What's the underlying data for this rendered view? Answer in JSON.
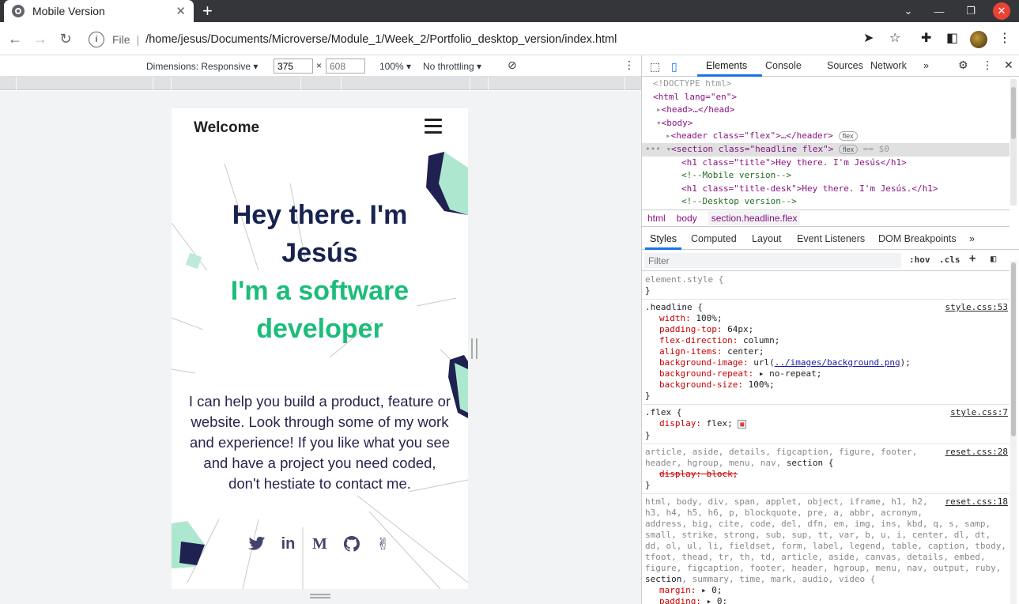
{
  "browser": {
    "tab_title": "Mobile Version",
    "omnibox": {
      "file_label": "File",
      "url": "/home/jesus/Documents/Microverse/Module_1/Week_2/Portfolio_desktop_version/index.html"
    }
  },
  "device_toolbar": {
    "dimensions_label": "Dimensions: Responsive",
    "width": "375",
    "times": "×",
    "height_placeholder": "608",
    "zoom": "100%",
    "throttling": "No throttling"
  },
  "page": {
    "logo": "Welcome",
    "headline_line1": "Hey there. I'm",
    "headline_line2": "Jesús",
    "subheadline_line1": "I'm a software",
    "subheadline_line2": "developer",
    "paragraph": "I can help you build a product, feature or website. Look through some of my work and experience! If you like what you see and have a project you need coded, don't hestiate to contact me.",
    "social_icons": [
      "twitter-icon",
      "linkedin-icon",
      "medium-icon",
      "github-icon",
      "angellist-icon"
    ],
    "colors": {
      "heading": "#172250",
      "accent": "#1cbd7a",
      "text": "#27254d"
    }
  },
  "devtools": {
    "tabs": [
      "Elements",
      "Console",
      "Sources",
      "Network"
    ],
    "dom": {
      "doctype": "<!DOCTYPE html>",
      "html_open": "<html lang=\"en\">",
      "head": "<head>…</head>",
      "body_open": "<body>",
      "header": "<header class=\"flex\">…</header>",
      "section": "<section class=\"headline flex\">",
      "selected_marker": "== $0",
      "h1_title": "<h1 class=\"title\">Hey there. I'm Jesús</h1>",
      "comment_mobile": "<!--Mobile version-->",
      "h1_desk": "<h1 class=\"title-desk\">Hey there. I'm Jesús.</h1>",
      "comment_desktop": "<!--Desktop version-->",
      "flex_pill": "flex"
    },
    "breadcrumbs": [
      "html",
      "body",
      "section.headline.flex"
    ],
    "styles_tabs": [
      "Styles",
      "Computed",
      "Layout",
      "Event Listeners",
      "DOM Breakpoints"
    ],
    "filter_placeholder": "Filter",
    "hov": ":hov",
    "cls": ".cls",
    "rules": {
      "element_style": "element.style {",
      "close": "}",
      "headline_selector": ".headline {",
      "headline_src": "style.css:53",
      "headline_props": [
        [
          "width",
          "100%;"
        ],
        [
          "padding-top",
          "64px;"
        ],
        [
          "flex-direction",
          "column;"
        ],
        [
          "align-items",
          "center;"
        ]
      ],
      "bg_image_prop": "background-image",
      "bg_image_pre": "url(",
      "bg_image_link": "../images/background.png",
      "bg_image_post": ");",
      "bg_repeat_prop": "background-repeat",
      "bg_repeat_val": "▸ no-repeat;",
      "bg_size_prop": "background-size",
      "bg_size_val": "100%;",
      "flex_selector": ".flex {",
      "flex_src": "style.css:7",
      "flex_prop": "display",
      "flex_val": "flex;",
      "reset1_src": "reset.css:28",
      "reset1_selector_a": "article, aside, details, figcaption, figure, footer,",
      "reset1_selector_b": "header, hgroup, menu, nav, ",
      "reset1_selector_c": "section {",
      "reset1_prop": "display: block;",
      "reset2_src": "reset.css:18",
      "reset2_lines": [
        "html, body, div, span, applet, object, iframe, h1, h2,",
        "h3, h4, h5, h6, p, blockquote, pre, a, abbr, acronym,",
        "address, big, cite, code, del, dfn, em, img, ins, kbd, q, s, samp,",
        "small, strike, strong, sub, sup, tt, var, b, u, i, center, dl, dt,",
        "dd, ol, ul, li, fieldset, form, label, legend, table, caption, tbody,",
        "tfoot, thead, tr, th, td, article, aside, canvas, details, embed,",
        "figure, figcaption, footer, header, hgroup, menu, nav, output, ruby,"
      ],
      "reset2_last_a": "section",
      "reset2_last_b": ", summary, time, mark, audio, video {",
      "reset2_props": [
        [
          "margin",
          "▸ 0;"
        ],
        [
          "padding",
          "▸ 0;"
        ]
      ]
    }
  }
}
